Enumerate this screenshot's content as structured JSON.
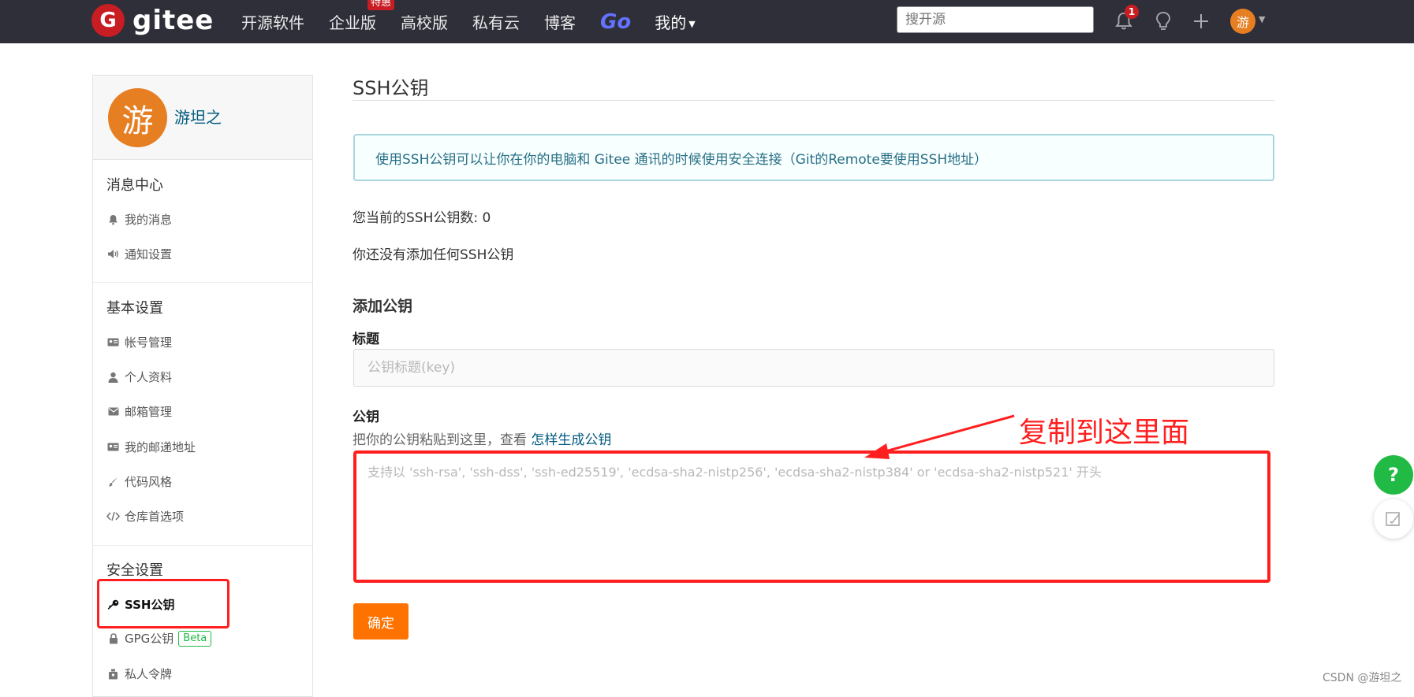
{
  "brand": {
    "logo_mark": "G",
    "name": "gitee",
    "accent": "#c71d23"
  },
  "nav": {
    "items": [
      {
        "label": "开源软件"
      },
      {
        "label": "企业版",
        "badge": "特惠"
      },
      {
        "label": "高校版"
      },
      {
        "label": "私有云"
      },
      {
        "label": "博客"
      },
      {
        "label": "Go"
      },
      {
        "label": "我的"
      }
    ]
  },
  "search": {
    "placeholder": "搜开源"
  },
  "notifications": {
    "count": "1"
  },
  "user": {
    "avatar_char": "游",
    "name": "游坦之"
  },
  "sidebar": {
    "sections": [
      {
        "title": "消息中心",
        "items": [
          {
            "label": "我的消息",
            "icon": "bell-icon"
          },
          {
            "label": "通知设置",
            "icon": "speaker-icon"
          }
        ]
      },
      {
        "title": "基本设置",
        "items": [
          {
            "label": "帐号管理",
            "icon": "id-card-icon"
          },
          {
            "label": "个人资料",
            "icon": "user-icon"
          },
          {
            "label": "邮箱管理",
            "icon": "envelope-icon"
          },
          {
            "label": "我的邮递地址",
            "icon": "address-card-icon"
          },
          {
            "label": "代码风格",
            "icon": "brush-icon"
          },
          {
            "label": "仓库首选项",
            "icon": "code-icon"
          }
        ]
      },
      {
        "title": "安全设置",
        "items": [
          {
            "label": "SSH公钥",
            "icon": "key-icon",
            "active": true
          },
          {
            "label": "GPG公钥",
            "icon": "lock-icon",
            "badge": "Beta"
          },
          {
            "label": "私人令牌",
            "icon": "token-icon"
          }
        ]
      }
    ]
  },
  "main": {
    "title": "SSH公钥",
    "info": "使用SSH公钥可以让你在你的电脑和 Gitee 通讯的时候使用安全连接（Git的Remote要使用SSH地址）",
    "key_count_text": "您当前的SSH公钥数: 0",
    "no_keys_text": "你还没有添加任何SSH公钥",
    "add_heading": "添加公钥",
    "title_label": "标题",
    "title_placeholder": "公钥标题(key)",
    "key_label": "公钥",
    "key_hint": "把你的公钥粘贴到这里，查看 ",
    "key_hint_link": "怎样生成公钥",
    "key_placeholder": "支持以 'ssh-rsa', 'ssh-dss', 'ssh-ed25519', 'ecdsa-sha2-nistp256', 'ecdsa-sha2-nistp384' or 'ecdsa-sha2-nistp521' 开头",
    "submit_label": "确定"
  },
  "annotation": {
    "text": "复制到这里面",
    "color": "#ff1f1f"
  },
  "float": {
    "help_label": "?"
  },
  "watermark": "CSDN @游坦之"
}
